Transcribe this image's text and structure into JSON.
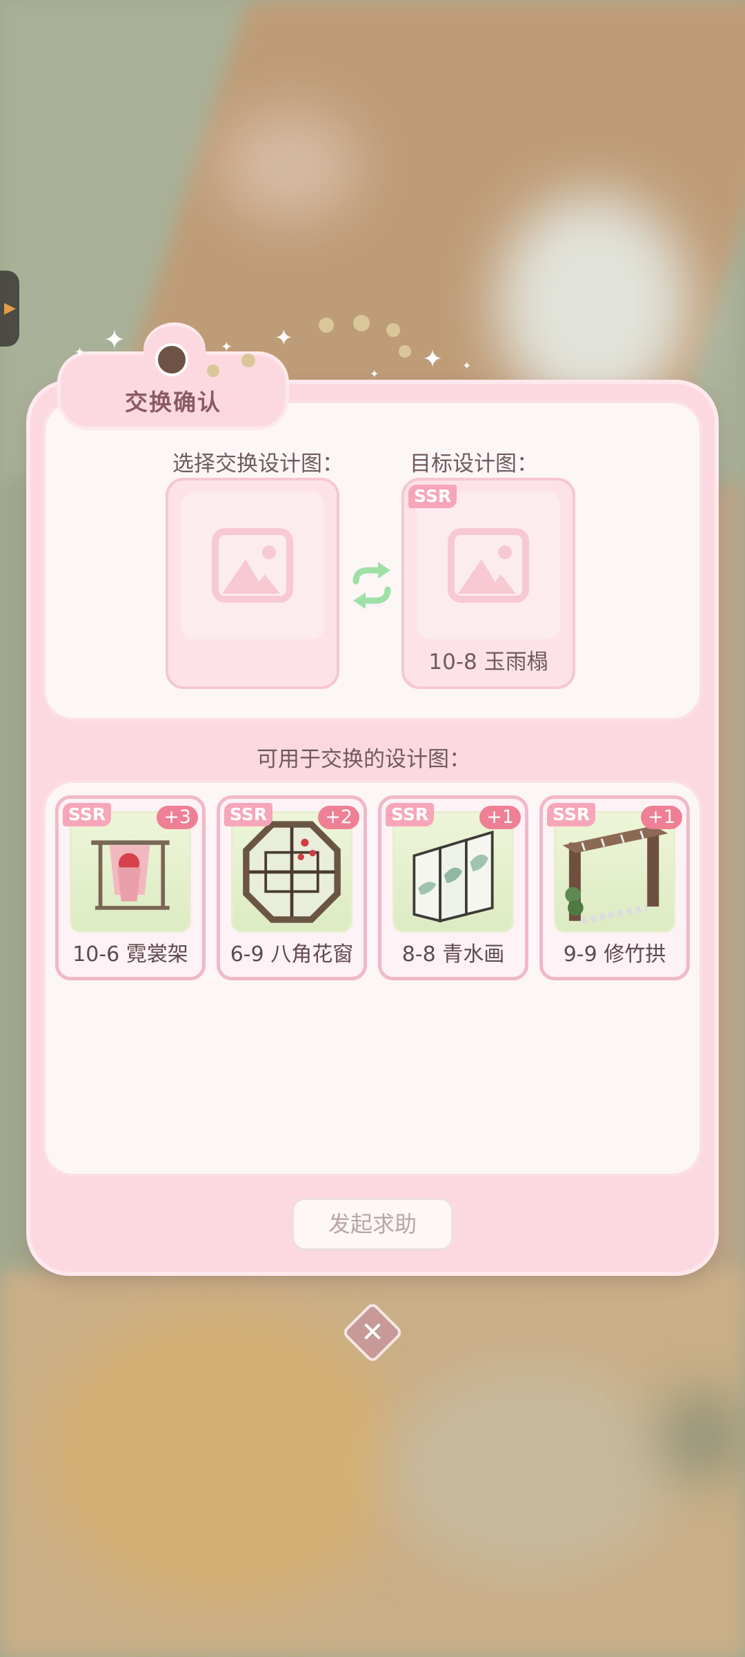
{
  "dialog": {
    "title": "交换确认",
    "select_label": "选择交换设计图：",
    "target_label": "目标设计图：",
    "target_item": {
      "rarity": "SSR",
      "name": "10-8 玉雨榻"
    },
    "available_label": "可用于交换的设计图：",
    "available_items": [
      {
        "rarity": "SSR",
        "count": "+3",
        "name": "10-6 霓裳架",
        "icon": "clothes-rack-icon"
      },
      {
        "rarity": "SSR",
        "count": "+2",
        "name": "6-9 八角花窗",
        "icon": "octagon-window-icon"
      },
      {
        "rarity": "SSR",
        "count": "+1",
        "name": "8-8 青水画",
        "icon": "folding-screen-icon"
      },
      {
        "rarity": "SSR",
        "count": "+1",
        "name": "9-9 修竹拱",
        "icon": "bamboo-arch-icon"
      }
    ],
    "help_button": "发起求助",
    "close_icon": "close-icon",
    "swap_icon": "swap-arrows-icon",
    "placeholder_icon": "image-placeholder-icon"
  },
  "colors": {
    "panel": "#fcd9e0",
    "inner": "#fdf6f7",
    "badge_ssr": "#f7a6b9",
    "badge_count": "#ef7f95",
    "swap_icon": "#9fe0a6",
    "close_button": "#c79a98"
  }
}
